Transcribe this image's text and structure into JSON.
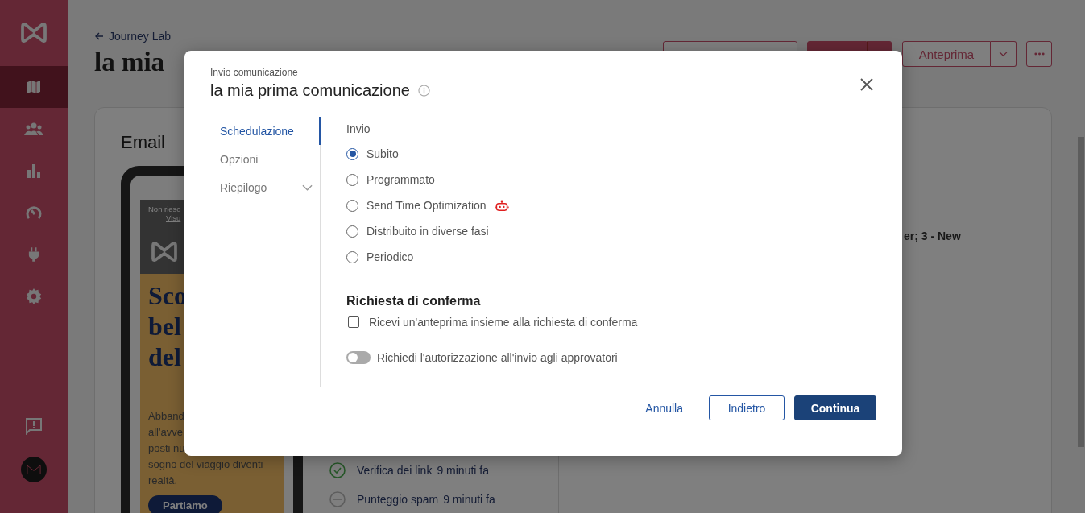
{
  "sidebar": {
    "items": [
      {
        "selected": true
      },
      {
        "selected": false
      },
      {
        "selected": false
      },
      {
        "selected": false
      },
      {
        "selected": false
      },
      {
        "selected": false
      }
    ]
  },
  "page": {
    "back_link": "Journey Lab",
    "title": "la mia",
    "preview_button": "Anteprima"
  },
  "card": {
    "title": "Email",
    "email_preview": {
      "preheader": "Non riesc",
      "view_link": "Visu",
      "headline": [
        "Sco",
        "bel",
        "del"
      ],
      "body": [
        "Abband",
        "all'avve",
        "posti nu",
        "sogno del viaggio diventi",
        "realtà."
      ],
      "cta": "Partiamo"
    },
    "checks": [
      {
        "label": "Verifica dei link",
        "time": "9 minuti fa",
        "kind": "ok"
      },
      {
        "label": "Punteggio spam",
        "time": "9 minuti fa",
        "kind": "pending"
      }
    ],
    "detail": "er; 3 - New"
  },
  "modal": {
    "eyebrow": "Invio comunicazione",
    "title": "la mia prima comunicazione",
    "steps": [
      {
        "label": "Schedulazione",
        "selected": true,
        "expandable": false
      },
      {
        "label": "Opzioni",
        "selected": false,
        "expandable": false
      },
      {
        "label": "Riepilogo",
        "selected": false,
        "expandable": true
      }
    ],
    "send": {
      "label": "Invio",
      "options": [
        {
          "label": "Subito",
          "selected": true,
          "ai_badge": false
        },
        {
          "label": "Programmato",
          "selected": false,
          "ai_badge": false
        },
        {
          "label": "Send Time Optimization",
          "selected": false,
          "ai_badge": true
        },
        {
          "label": "Distribuito in diverse fasi",
          "selected": false,
          "ai_badge": false
        },
        {
          "label": "Periodico",
          "selected": false,
          "ai_badge": false
        }
      ]
    },
    "confirmation": {
      "title": "Richiesta di conferma",
      "preview_checkbox": {
        "label": "Ricevi un'anteprima insieme alla richiesta di conferma",
        "checked": false
      },
      "approval_toggle": {
        "label": "Richiedi l'autorizzazione all'invio agli approvatori",
        "on": false
      }
    },
    "buttons": {
      "cancel": "Annulla",
      "back": "Indietro",
      "continue": "Continua"
    }
  }
}
